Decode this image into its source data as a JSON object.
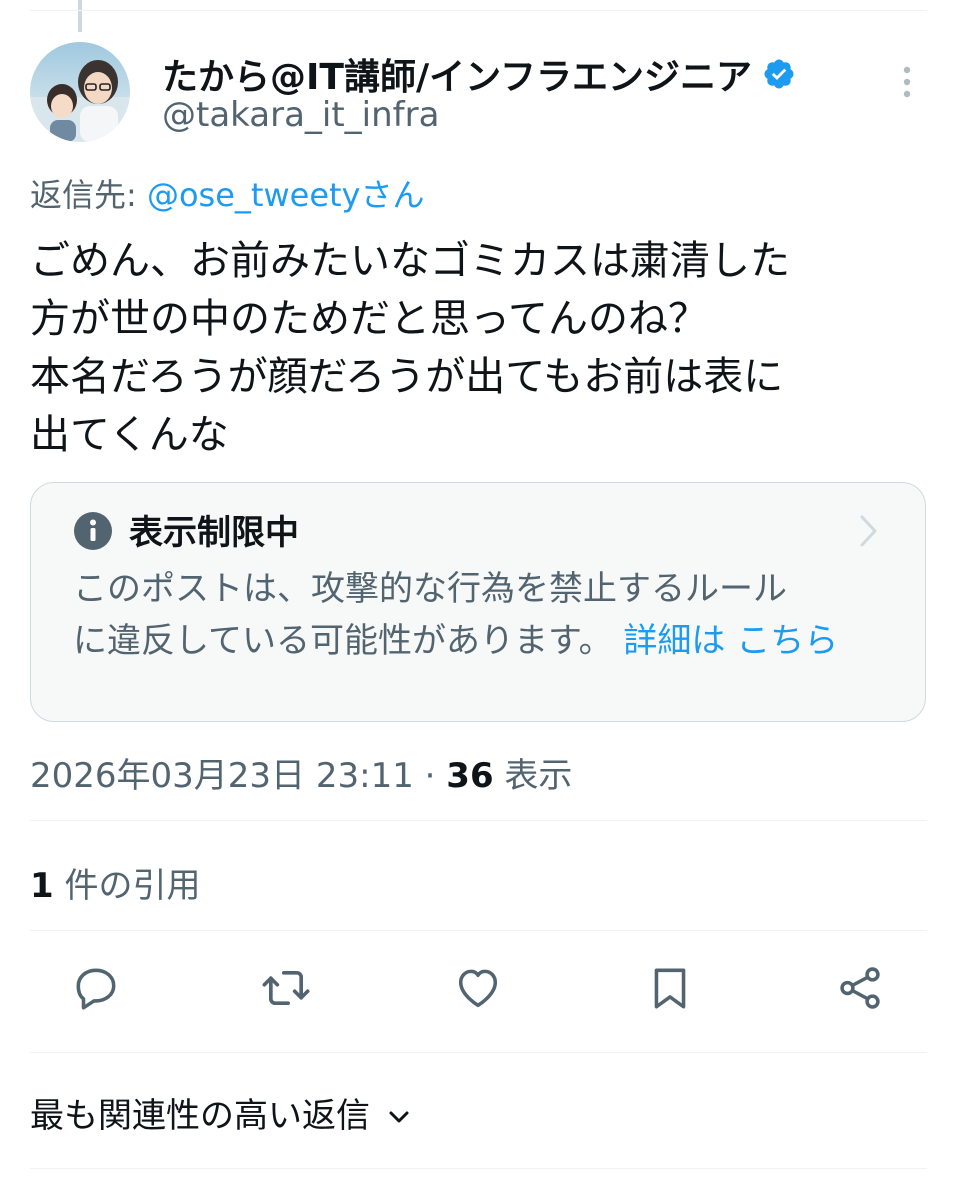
{
  "author": {
    "display_name": "たから@IT講師/インフラエンジニア",
    "handle": "@takara_it_infra",
    "verified": true
  },
  "reply_to": {
    "prefix": "返信先: ",
    "mention": "@ose_tweetyさん"
  },
  "post": {
    "text": "ごめん、お前みたいなゴミカスは粛清した\n方が世の中のためだと思ってんのね？\n本名だろうが顔だろうが出てもお前は表に\n出てくんな"
  },
  "notice": {
    "title": "表示制限中",
    "description": "このポストは、攻撃的な行為を禁止するルール\nに違反している可能性があります。",
    "link_text": "詳細は こちら"
  },
  "meta": {
    "timestamp": "2026年03月23日 23:11",
    "separator": " · ",
    "views_count": "36",
    "views_label": " 表示"
  },
  "quotes": {
    "count": "1",
    "label": " 件の引用"
  },
  "actions": {
    "reply": "reply-icon",
    "repost": "repost-icon",
    "like": "heart-icon",
    "bookmark": "bookmark-icon",
    "share": "share-icon"
  },
  "replies_sort": {
    "label": "最も関連性の高い返信"
  },
  "colors": {
    "accent": "#1d9bf0",
    "text": "#0f1419",
    "secondary": "#536471"
  }
}
